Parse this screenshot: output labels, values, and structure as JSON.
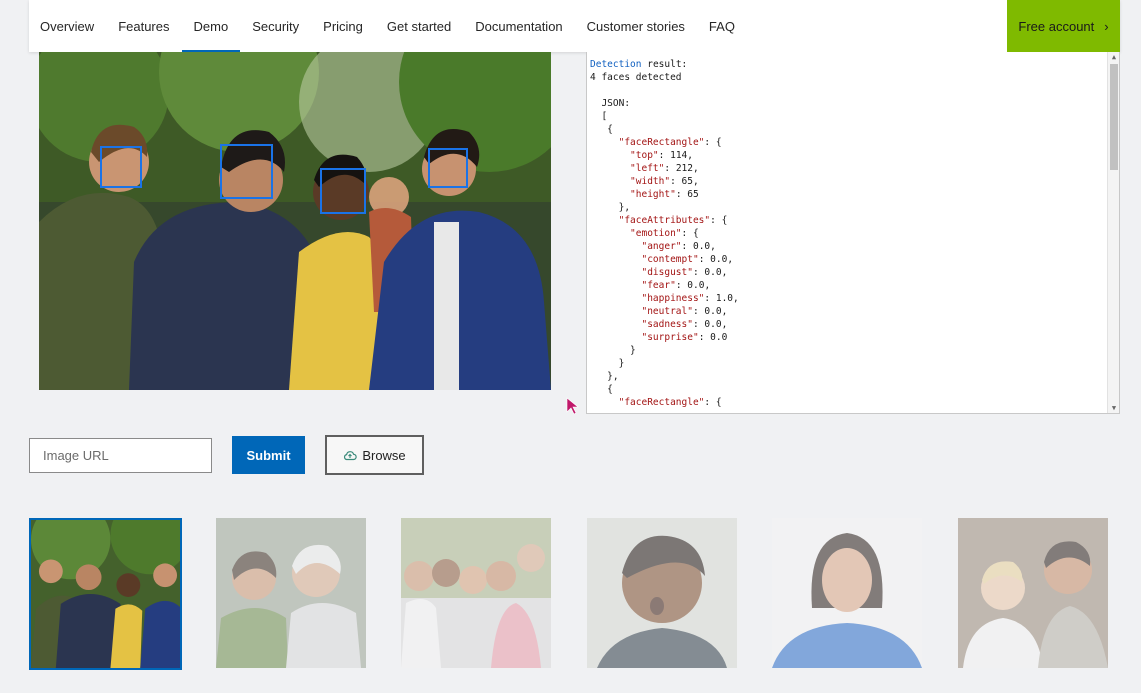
{
  "nav": {
    "items": [
      {
        "label": "Overview",
        "active": false
      },
      {
        "label": "Features",
        "active": false
      },
      {
        "label": "Demo",
        "active": true
      },
      {
        "label": "Security",
        "active": false
      },
      {
        "label": "Pricing",
        "active": false
      },
      {
        "label": "Get started",
        "active": false
      },
      {
        "label": "Documentation",
        "active": false
      },
      {
        "label": "Customer stories",
        "active": false
      },
      {
        "label": "FAQ",
        "active": false
      }
    ],
    "cta_label": "Free account",
    "cta_icon": "chevron-right-icon"
  },
  "result": {
    "detection_word": "Detection",
    "result_word": "result:",
    "summary": "4 faces detected",
    "json_label": "JSON:",
    "face": {
      "top": "114",
      "left": "212",
      "width": "65",
      "height": "65"
    },
    "emotion": {
      "anger": "0.0",
      "contempt": "0.0",
      "disgust": "0.0",
      "fear": "0.0",
      "happiness": "1.0",
      "neutral": "0.0",
      "sadness": "0.0",
      "surprise": "0.0"
    }
  },
  "controls": {
    "url_placeholder": "Image URL",
    "url_value": "",
    "submit_label": "Submit",
    "browse_label": "Browse",
    "browse_icon": "upload-cloud-icon"
  },
  "thumbnails": [
    {
      "subject": "group of four friends outdoors",
      "selected": true
    },
    {
      "subject": "elderly couple",
      "selected": false
    },
    {
      "subject": "family group selfie",
      "selected": false
    },
    {
      "subject": "surprised child",
      "selected": false
    },
    {
      "subject": "woman making face",
      "selected": false
    },
    {
      "subject": "man and baby surprised",
      "selected": false
    }
  ],
  "colors": {
    "accent": "#0067b8",
    "cta": "#7fba00",
    "face_box": "#1a73e8",
    "background": "#f0f1f3"
  }
}
